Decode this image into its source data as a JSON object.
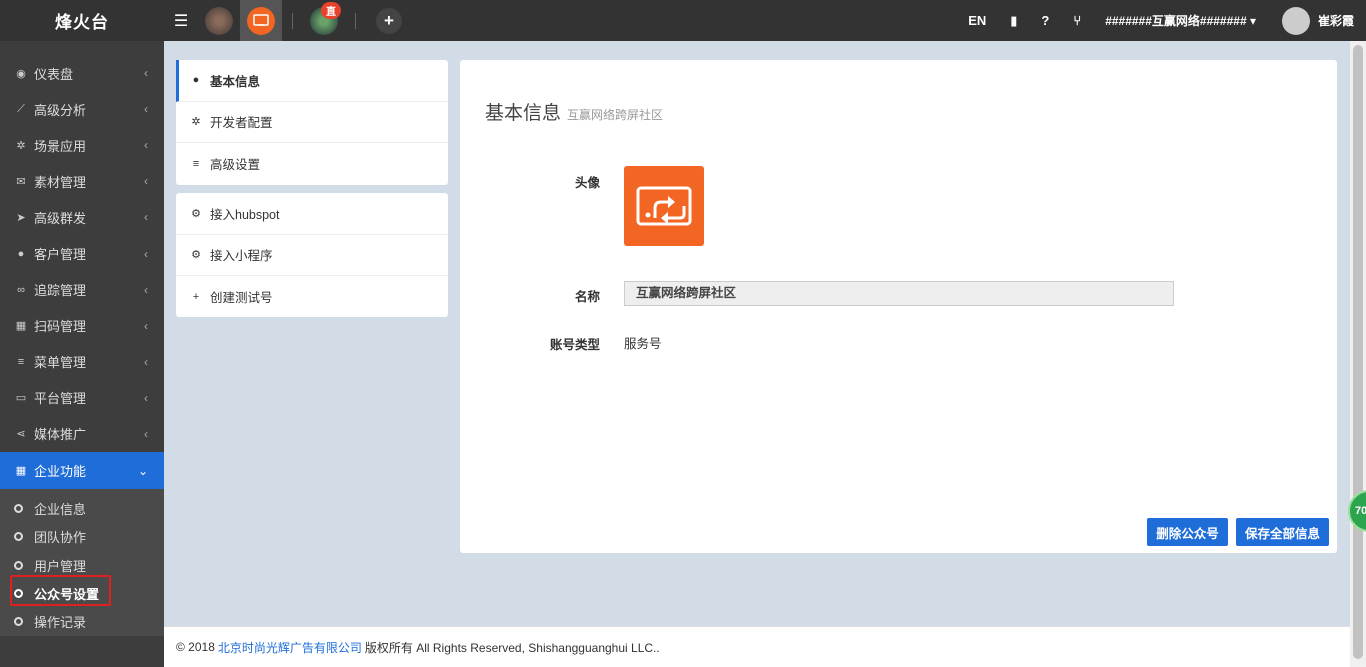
{
  "topbar": {
    "brand": "烽火台",
    "live_badge": "直",
    "lang": "EN",
    "account": "#######互赢网络####### ▾",
    "user_name": "崔彩霞"
  },
  "sidebar": {
    "items": [
      {
        "label": "仪表盘",
        "icon": "dashboard-icon"
      },
      {
        "label": "高级分析",
        "icon": "line-chart-icon"
      },
      {
        "label": "场景应用",
        "icon": "gear-icon"
      },
      {
        "label": "素材管理",
        "icon": "envelope-icon"
      },
      {
        "label": "高级群发",
        "icon": "send-icon"
      },
      {
        "label": "客户管理",
        "icon": "user-icon"
      },
      {
        "label": "追踪管理",
        "icon": "link-icon"
      },
      {
        "label": "扫码管理",
        "icon": "qrcode-icon"
      },
      {
        "label": "菜单管理",
        "icon": "list-icon"
      },
      {
        "label": "平台管理",
        "icon": "monitor-icon"
      },
      {
        "label": "媒体推广",
        "icon": "share-icon"
      }
    ],
    "open_item": {
      "label": "企业功能",
      "icon": "grid-icon"
    },
    "sub_items": [
      "企业信息",
      "团队协作",
      "用户管理",
      "公众号设置",
      "操作记录"
    ]
  },
  "settings_menu": {
    "group1": [
      {
        "label": "基本信息",
        "icon": "user-icon"
      },
      {
        "label": "开发者配置",
        "icon": "gear-icon"
      },
      {
        "label": "高级设置",
        "icon": "list-icon"
      }
    ],
    "group2": [
      {
        "label": "接入hubspot",
        "icon": "cogs-icon"
      },
      {
        "label": "接入小程序",
        "icon": "cogs-icon"
      },
      {
        "label": "创建测试号",
        "icon": "plus-icon"
      }
    ]
  },
  "content": {
    "title": "基本信息",
    "subtitle": "互赢网络跨屏社区",
    "avatar_label": "头像",
    "name_label": "名称",
    "name_value": "互赢网络跨屏社区",
    "type_label": "账号类型",
    "type_value": "服务号",
    "delete_button": "删除公众号",
    "save_button": "保存全部信息"
  },
  "footer": {
    "prefix": "© 2018",
    "company": "北京时尚光辉广告有限公司",
    "suffix": "版权所有 All Rights Reserved, Shishangguanghui LLC.."
  },
  "float_badge": "70"
}
